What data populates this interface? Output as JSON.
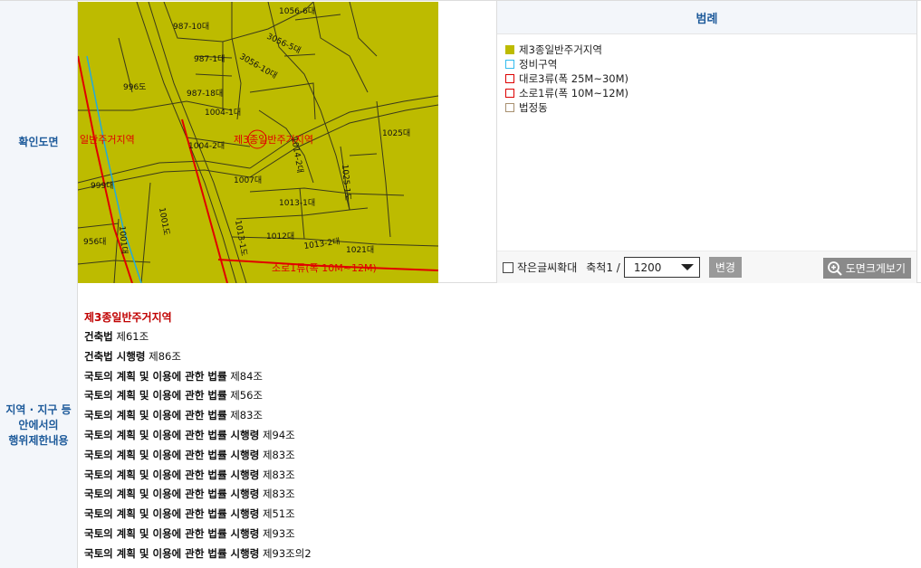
{
  "map_section": {
    "header": "확인도면",
    "map_labels": [
      "987-10대",
      "1056-6대",
      "3056-5대",
      "3056-10대",
      "996도",
      "987-18대",
      "987-1대",
      "1004-1대",
      "1004-2대",
      "1007대",
      "1013-1대",
      "1012대",
      "1013-2대",
      "1021대",
      "1025대",
      "1014-2대",
      "1025-1도",
      "1001도",
      "1001대",
      "999대",
      "956대",
      "1013-1도",
      "일반주거지역",
      "제3종일반주거지역",
      "소로1류(폭 10M~12M)"
    ],
    "legend_title": "범례",
    "legend_items": [
      {
        "label": "제3종일반주거지역",
        "color": "#bdbb00",
        "style": "fill"
      },
      {
        "label": "정비구역",
        "color": "#33bbee",
        "style": "outline"
      },
      {
        "label": "대로3류(폭 25M~30M)",
        "color": "#dd0000",
        "style": "outline"
      },
      {
        "label": "소로1류(폭 10M~12M)",
        "color": "#dd0000",
        "style": "outline"
      },
      {
        "label": "법정동",
        "color": "#a89070",
        "style": "outline"
      }
    ],
    "toolbar": {
      "small_text_zoom": "작은글씨확대",
      "scale_label": "축척1 /",
      "scale_value": "1200",
      "change_button": "변경",
      "enlarge_button": "도면크게보기"
    }
  },
  "rules_section": {
    "header_lines": [
      "지역 · 지구 등",
      "안에서의",
      "행위제한내용"
    ],
    "zone_name": "제3종일반주거지역",
    "laws": [
      {
        "name": "건축법",
        "article": "제61조"
      },
      {
        "name": "건축법 시행령",
        "article": "제86조"
      },
      {
        "name": "국토의 계획 및 이용에 관한 법률",
        "article": "제84조"
      },
      {
        "name": "국토의 계획 및 이용에 관한 법률",
        "article": "제56조"
      },
      {
        "name": "국토의 계획 및 이용에 관한 법률",
        "article": "제83조"
      },
      {
        "name": "국토의 계획 및 이용에 관한 법률 시행령",
        "article": "제94조"
      },
      {
        "name": "국토의 계획 및 이용에 관한 법률 시행령",
        "article": "제83조"
      },
      {
        "name": "국토의 계획 및 이용에 관한 법률 시행령",
        "article": "제83조"
      },
      {
        "name": "국토의 계획 및 이용에 관한 법률 시행령",
        "article": "제83조"
      },
      {
        "name": "국토의 계획 및 이용에 관한 법률 시행령",
        "article": "제51조"
      },
      {
        "name": "국토의 계획 및 이용에 관한 법률 시행령",
        "article": "제93조"
      },
      {
        "name": "국토의 계획 및 이용에 관한 법률 시행령",
        "article": "제93조의2"
      }
    ]
  }
}
